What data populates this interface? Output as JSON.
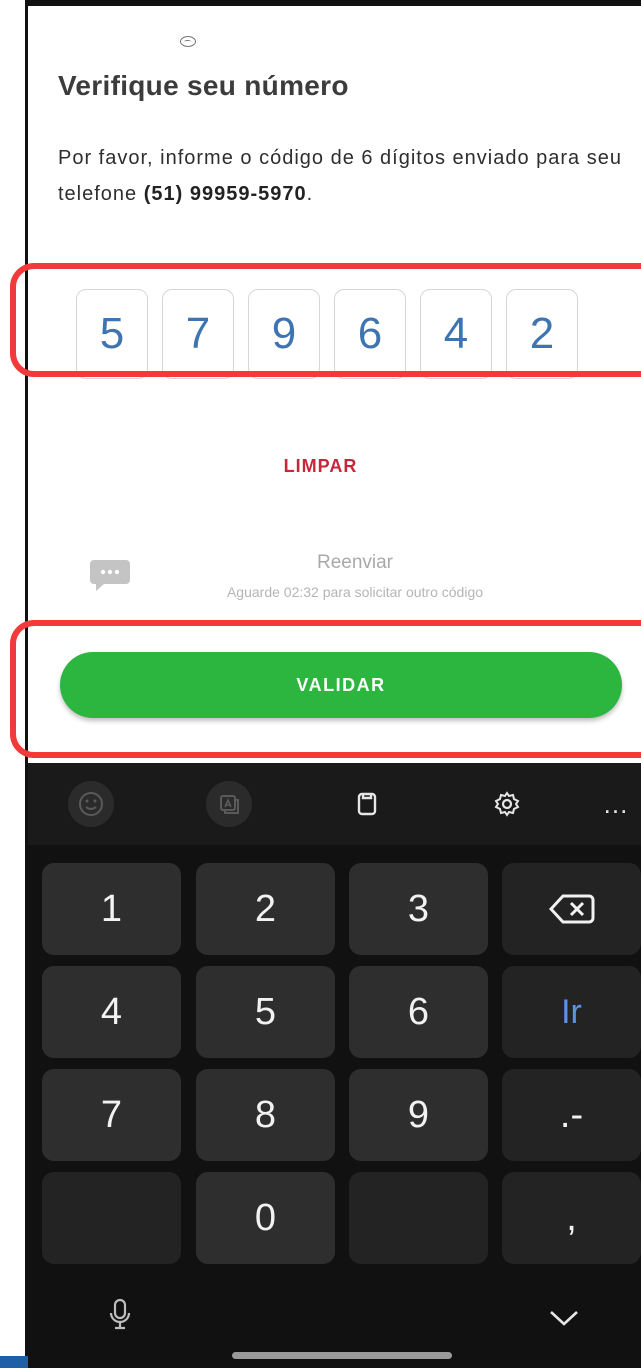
{
  "header": {
    "title": "Verifique seu número",
    "description_prefix": "Por favor, informe o código de 6 dígitos enviado para seu telefone ",
    "phone": "(51) 99959-5970",
    "description_suffix": "."
  },
  "otp": {
    "digits": [
      "5",
      "7",
      "9",
      "6",
      "4",
      "2"
    ]
  },
  "actions": {
    "clear_label": "LIMPAR",
    "resend_label": "Reenviar",
    "resend_wait": "Aguarde 02:32 para solicitar outro código",
    "validate_label": "VALIDAR"
  },
  "keyboard": {
    "more_label": "...",
    "rows": [
      [
        "1",
        "2",
        "3",
        "⌫"
      ],
      [
        "4",
        "5",
        "6",
        "Ir"
      ],
      [
        "7",
        "8",
        "9",
        ".-"
      ],
      [
        "",
        "0",
        "",
        ","
      ]
    ]
  },
  "colors": {
    "accent_green": "#2db63f",
    "clear_red": "#c8273a",
    "digit_blue": "#3e75b0",
    "highlight_red": "#f23a3a"
  }
}
